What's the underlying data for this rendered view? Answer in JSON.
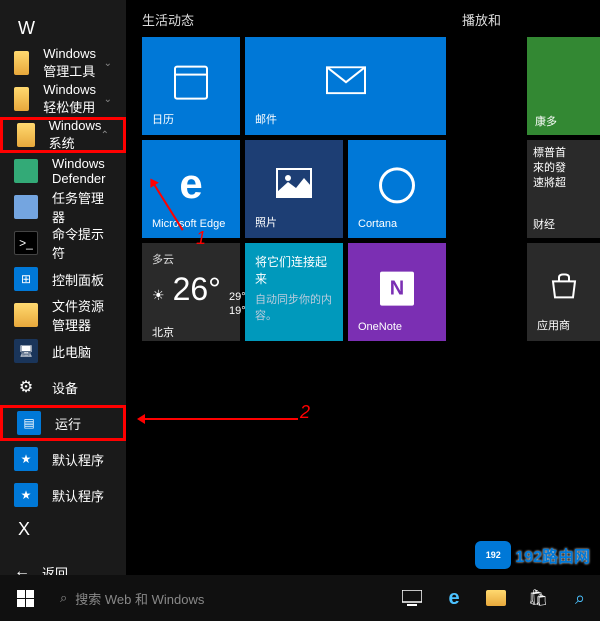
{
  "sections": {
    "w": "W",
    "x": "X"
  },
  "apps": {
    "admin_tools": "Windows 管理工具",
    "ease": "Windows 轻松使用",
    "system": "Windows 系统",
    "defender": "Windows Defender",
    "taskmgr": "任务管理器",
    "cmd": "命令提示符",
    "control": "控制面板",
    "explorer": "文件资源管理器",
    "thispc": "此电脑",
    "devices": "设备",
    "run": "运行",
    "default1": "默认程序",
    "default2": "默认程序"
  },
  "back": "返回",
  "zones": {
    "life": "生活动态",
    "play": "播放和"
  },
  "tiles": {
    "calendar": "日历",
    "mail": "邮件",
    "edge": "Microsoft Edge",
    "photos": "照片",
    "cortana": "Cortana",
    "onenote": "OneNote",
    "store": "应用商",
    "money": "财经",
    "game": "康多",
    "sync_title": "将它们连接起来",
    "sync_sub": "自动同步你的内容。",
    "game2_l1": "標普首",
    "game2_l2": "來的發",
    "game2_l3": "速將超"
  },
  "weather": {
    "cond": "多云",
    "temp": "26",
    "hi": "29°",
    "lo": "19°",
    "city": "北京"
  },
  "search_placeholder": "搜索 Web 和 Windows",
  "annotations": {
    "one": "1",
    "two": "2"
  },
  "watermark": {
    "badge": "192",
    "text": "192路由网"
  }
}
